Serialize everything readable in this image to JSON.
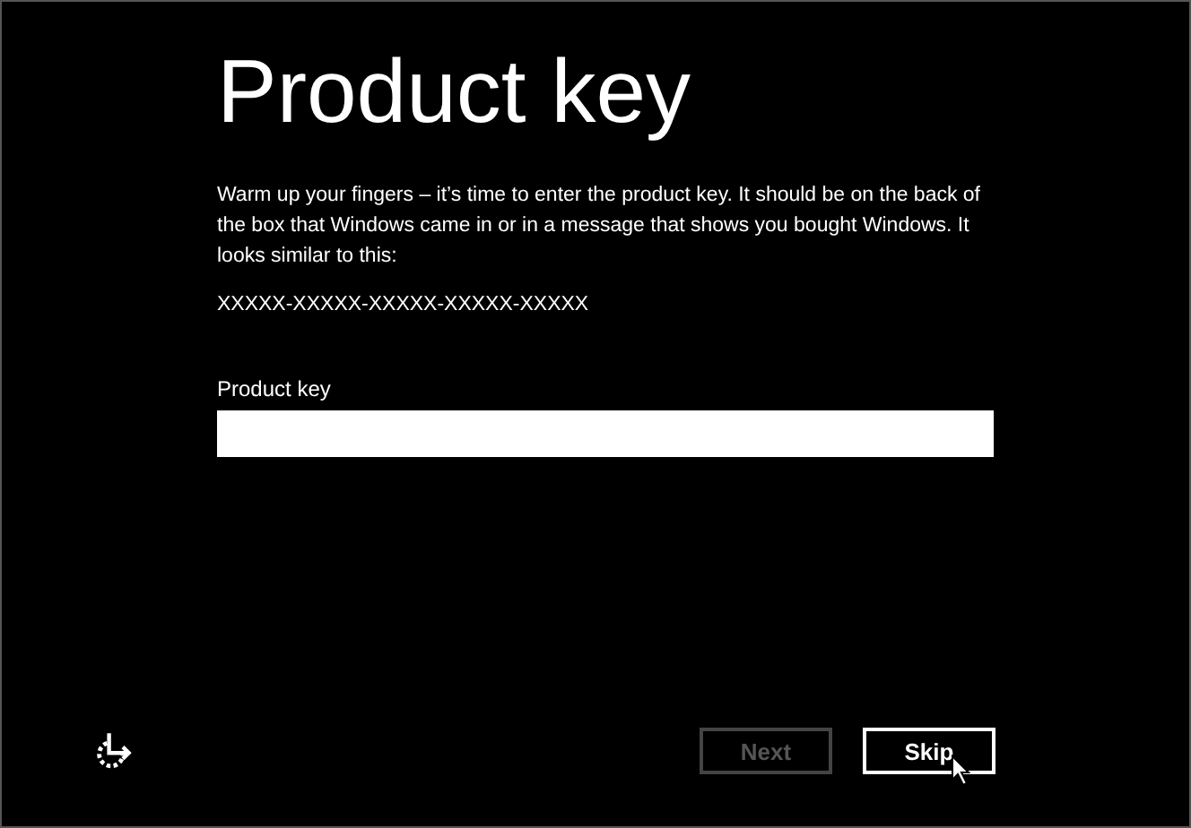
{
  "title": "Product key",
  "description": "Warm up your fingers – it’s time to enter the product key. It should be on the back of the box that Windows came in or in a message that shows you bought Windows. It looks similar to this:",
  "key_example": "XXXXX-XXXXX-XXXXX-XXXXX-XXXXX",
  "field": {
    "label": "Product key"
  },
  "buttons": [
    {
      "label": "Next",
      "disabled": true
    },
    {
      "label": "Skip",
      "disabled": false
    }
  ]
}
